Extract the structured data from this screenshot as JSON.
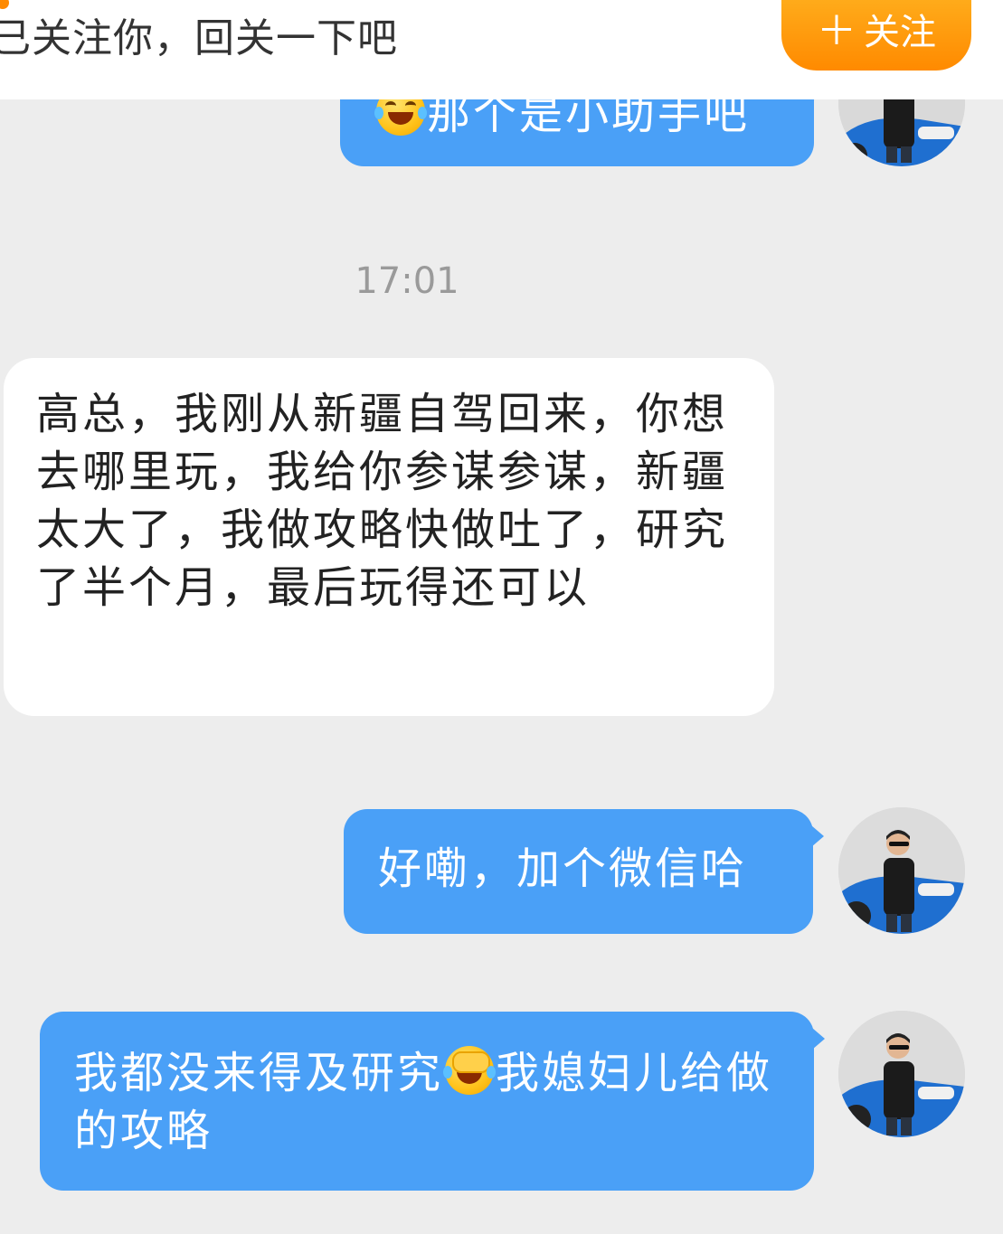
{
  "follow_bar": {
    "text": "已关注你，回关一下吧",
    "button_label": "关注",
    "button_icon": "plus-icon",
    "accent_color": "#ff8a00"
  },
  "messages": [
    {
      "sender": "me",
      "pre_emoji": "laughing-tears-emoji",
      "text": "那个是小助手吧"
    },
    {
      "sender": "other",
      "text": "高总，我刚从新疆自驾回来，你想去哪里玩，我给你参谋参谋，新疆太大了，我做攻略快做吐了，研究了半个月，最后玩得还可以"
    },
    {
      "sender": "me",
      "text": "好嘞，加个微信哈"
    },
    {
      "sender": "me",
      "text_before": "我都没来得及研究",
      "emoji": "facepalm-laugh-emoji",
      "text_after": "我媳妇儿给做的攻略"
    }
  ],
  "timestamp": "17:01",
  "colors": {
    "background": "#ededed",
    "my_bubble": "#4aa0f7",
    "other_bubble": "#ffffff"
  }
}
